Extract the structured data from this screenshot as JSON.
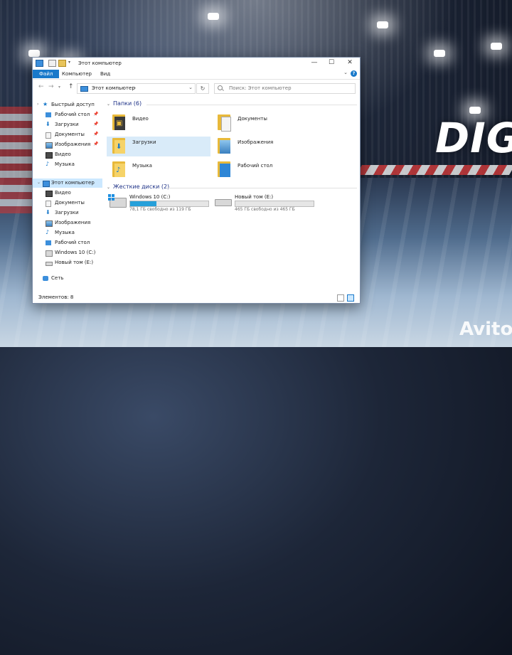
{
  "window": {
    "title": "Этот компьютер",
    "controls": {
      "minimize": "—",
      "maximize": "☐",
      "close": "✕"
    }
  },
  "ribbon": {
    "tabs": [
      "Файл",
      "Компьютер",
      "Вид"
    ],
    "help": "?"
  },
  "navigation": {
    "back": "←",
    "forward": "→",
    "up": "↑",
    "address_path": "Этот компьютер",
    "refresh": "↻",
    "search_placeholder": "Поиск: Этот компьютер"
  },
  "nav_pane": {
    "quick_access": "Быстрый доступ",
    "quick_items": [
      {
        "label": "Рабочий стол",
        "pinned": true,
        "icon": "desktop-icon"
      },
      {
        "label": "Загрузки",
        "pinned": true,
        "icon": "downloads-icon"
      },
      {
        "label": "Документы",
        "pinned": true,
        "icon": "documents-icon"
      },
      {
        "label": "Изображения",
        "pinned": true,
        "icon": "pictures-icon"
      },
      {
        "label": "Видео",
        "pinned": false,
        "icon": "videos-icon"
      },
      {
        "label": "Музыка",
        "pinned": false,
        "icon": "music-icon"
      }
    ],
    "this_pc": "Этот компьютер",
    "pc_items": [
      {
        "label": "Видео",
        "icon": "videos-icon"
      },
      {
        "label": "Документы",
        "icon": "documents-icon"
      },
      {
        "label": "Загрузки",
        "icon": "downloads-icon"
      },
      {
        "label": "Изображения",
        "icon": "pictures-icon"
      },
      {
        "label": "Музыка",
        "icon": "music-icon"
      },
      {
        "label": "Рабочий стол",
        "icon": "desktop-icon"
      },
      {
        "label": "Windows 10 (C:)",
        "icon": "windows-drive-icon"
      },
      {
        "label": "Новый том (E:)",
        "icon": "drive-icon"
      }
    ],
    "network": "Сеть"
  },
  "content": {
    "folders_header": "Папки (6)",
    "folders": [
      {
        "label": "Видео",
        "icon": "videos-folder-icon"
      },
      {
        "label": "Документы",
        "icon": "documents-folder-icon"
      },
      {
        "label": "Загрузки",
        "icon": "downloads-folder-icon",
        "selected": true
      },
      {
        "label": "Изображения",
        "icon": "pictures-folder-icon"
      },
      {
        "label": "Музыка",
        "icon": "music-folder-icon"
      },
      {
        "label": "Рабочий стол",
        "icon": "desktop-folder-icon"
      }
    ],
    "drives_header": "Жесткие диски (2)",
    "drives": [
      {
        "name": "Windows 10 (C:)",
        "free_text": "78,1 ГБ свободно из 119 ГБ",
        "used_fraction": 0.34,
        "icon": "windows-drive-icon"
      },
      {
        "name": "Новый том (E:)",
        "free_text": "465 ГБ свободно из 465 ГБ",
        "used_fraction": 0.0,
        "icon": "drive-icon"
      }
    ]
  },
  "status": {
    "items": "Элементов: 8"
  },
  "colors": {
    "accent": "#1979ca",
    "selection": "#cce8ff",
    "drive_fill": "#26a0da",
    "folder": "#f6d368"
  },
  "background": {
    "brand": "DIG",
    "watermark": "Avito"
  }
}
